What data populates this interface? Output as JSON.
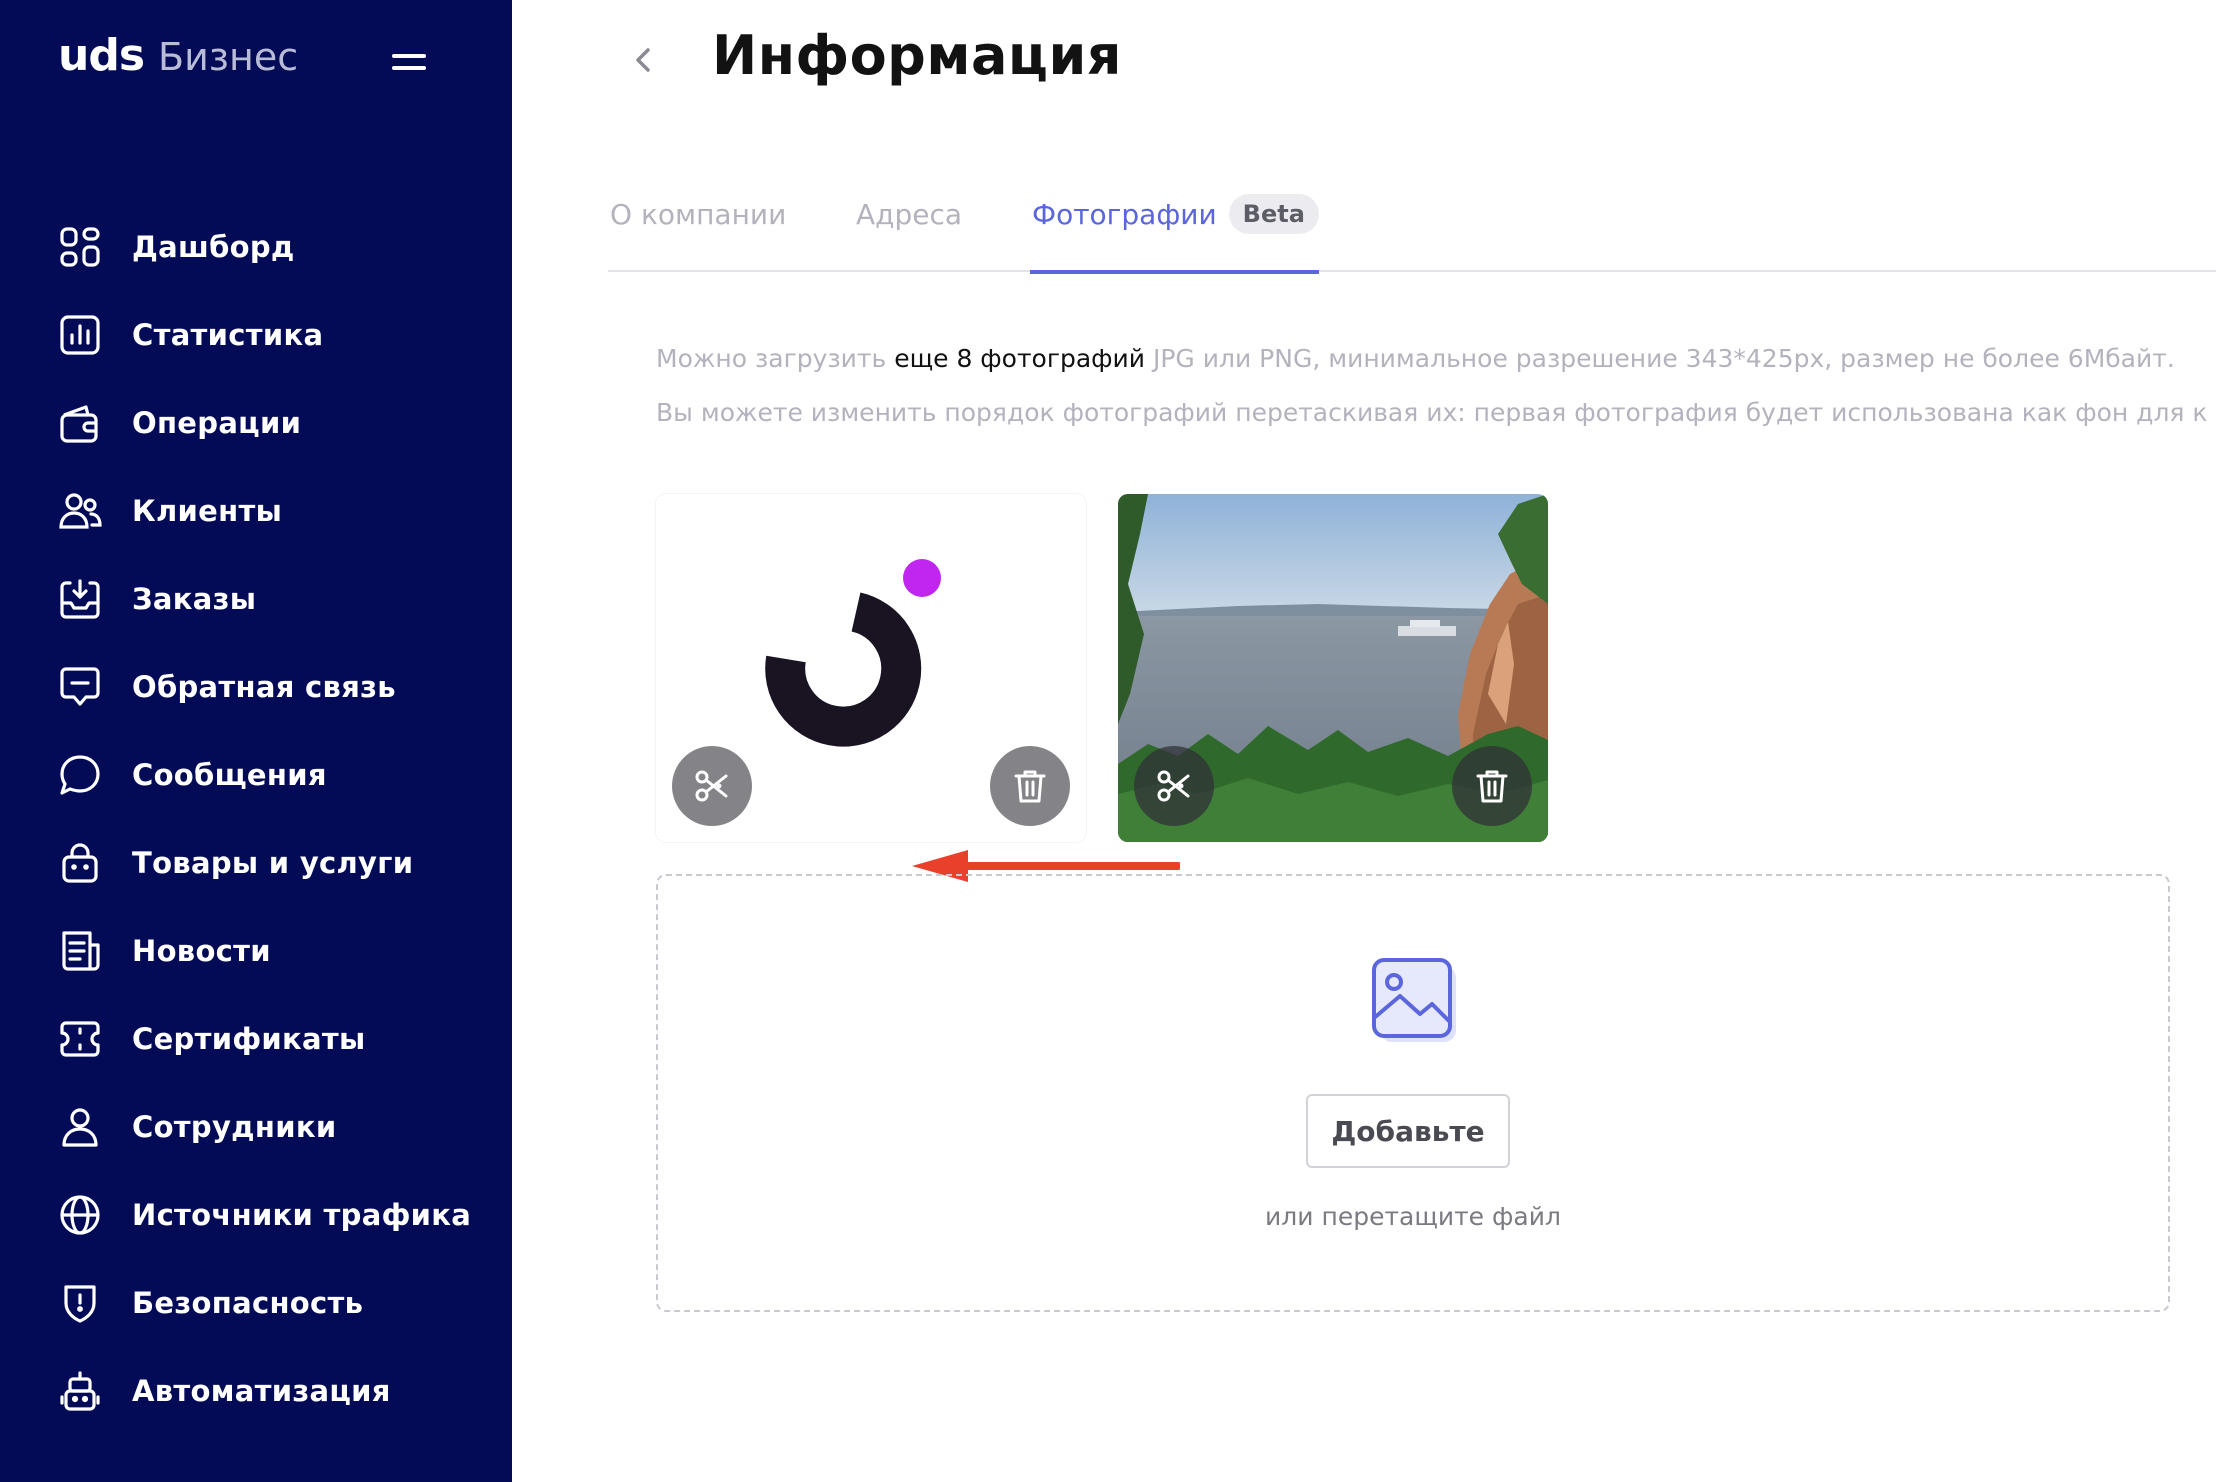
{
  "brand": {
    "logo_main": "uds",
    "logo_sub": "Бизнес"
  },
  "sidebar": {
    "items": [
      {
        "label": "Дашборд",
        "icon": "dashboard-icon"
      },
      {
        "label": "Статистика",
        "icon": "statistics-icon"
      },
      {
        "label": "Операции",
        "icon": "operations-icon"
      },
      {
        "label": "Клиенты",
        "icon": "clients-icon"
      },
      {
        "label": "Заказы",
        "icon": "orders-icon"
      },
      {
        "label": "Обратная связь",
        "icon": "feedback-icon"
      },
      {
        "label": "Сообщения",
        "icon": "messages-icon"
      },
      {
        "label": "Товары и услуги",
        "icon": "goods-icon"
      },
      {
        "label": "Новости",
        "icon": "news-icon"
      },
      {
        "label": "Сертификаты",
        "icon": "certificates-icon"
      },
      {
        "label": "Сотрудники",
        "icon": "employees-icon"
      },
      {
        "label": "Источники трафика",
        "icon": "globe-icon"
      },
      {
        "label": "Безопасность",
        "icon": "shield-icon"
      },
      {
        "label": "Автоматизация",
        "icon": "robot-icon"
      }
    ]
  },
  "header": {
    "title": "Информация"
  },
  "tabs": {
    "about": "О компании",
    "addresses": "Адреса",
    "photos": "Фотографии",
    "photos_badge": "Beta",
    "active": "photos"
  },
  "info": {
    "line1_pre": "Можно загрузить",
    "line1_highlight": "еще 8 фотографий",
    "line1_post": "JPG или PNG, минимальное разрешение 343*425px, размер не более 6Мбайт.",
    "line2": "Вы можете изменить порядок фотографий перетаскивая их: первая фотография будет использована как фон для к"
  },
  "upload": {
    "button_label": "Добавьте",
    "hint": "или перетащите файл"
  },
  "colors": {
    "sidebar_bg": "#030b57",
    "accent": "#5b66dc",
    "logo_dot": "#c026f0",
    "annotation_arrow": "#e8402a"
  }
}
